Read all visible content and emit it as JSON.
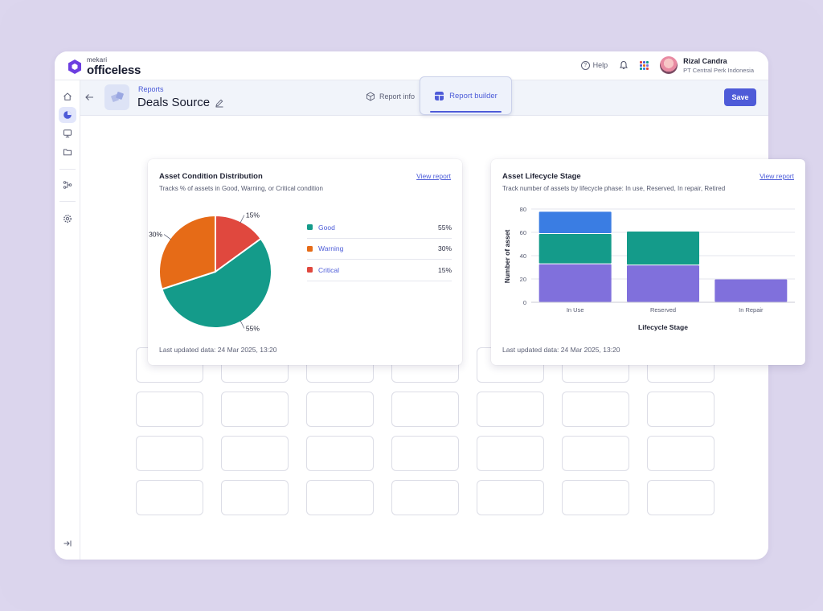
{
  "brand": {
    "company": "mekari",
    "product": "officeless"
  },
  "topbar": {
    "help_label": "Help",
    "user_name": "Rizal Candra",
    "user_org": "PT Central Perk Indonesia"
  },
  "header": {
    "breadcrumb": "Reports",
    "title": "Deals Source",
    "tab_info": "Report info",
    "tab_builder": "Report builder",
    "save_label": "Save"
  },
  "colors": {
    "accent": "#4e5bd8",
    "good": "#149b8a",
    "warning": "#e66b17",
    "critical": "#e0483e",
    "in_use_top": "#3a7de3",
    "purple": "#8070dc"
  },
  "cards": [
    {
      "title": "Asset Condition Distribution",
      "subtitle": "Tracks % of assets in Good, Warning, or Critical condition",
      "link": "View report",
      "footer": "Last updated data: 24 Mar 2025, 13:20",
      "legend": [
        {
          "name": "Good",
          "value": "55%"
        },
        {
          "name": "Warning",
          "value": "30%"
        },
        {
          "name": "Critical",
          "value": "15%"
        }
      ]
    },
    {
      "title": "Asset Lifecycle Stage",
      "subtitle": "Track number of assets by lifecycle phase: In use, Reserved, In repair, Retired",
      "link": "View report",
      "footer": "Last updated data: 24 Mar 2025, 13:20"
    }
  ],
  "chart_data": [
    {
      "type": "pie",
      "categories": [
        "Good",
        "Warning",
        "Critical"
      ],
      "values": [
        55,
        30,
        15
      ],
      "labels": [
        "55%",
        "30%",
        "15%"
      ],
      "colors": [
        "#149b8a",
        "#e66b17",
        "#e0483e"
      ]
    },
    {
      "type": "bar",
      "stacked": true,
      "categories": [
        "In Use",
        "Reserved",
        "In Repair"
      ],
      "series": [
        {
          "values": [
            33,
            32,
            20
          ],
          "color": "#8070dc"
        },
        {
          "values": [
            26,
            29,
            0
          ],
          "color": "#149b8a"
        },
        {
          "values": [
            19,
            0,
            0
          ],
          "color": "#3a7de3"
        }
      ],
      "xlabel": "Lifecycle Stage",
      "ylabel": "Number of asset",
      "ylim": [
        0,
        80
      ],
      "yticks": [
        0,
        20,
        40,
        60,
        80
      ],
      "grid": true
    }
  ]
}
